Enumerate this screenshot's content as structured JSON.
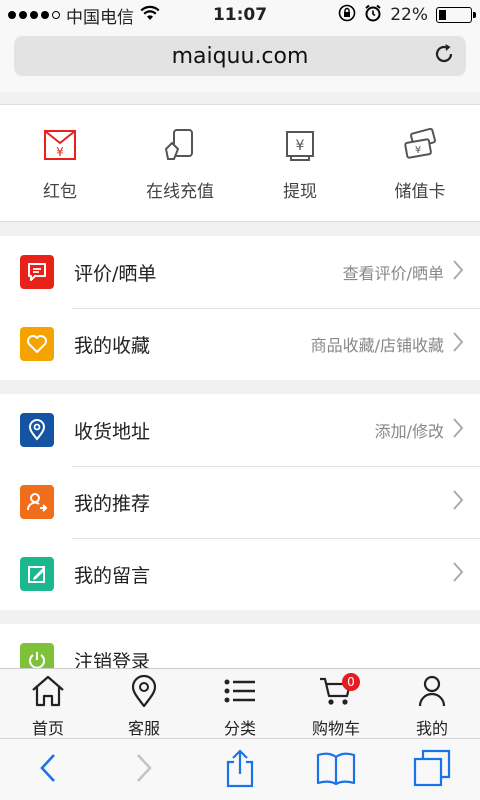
{
  "status": {
    "carrier": "中国电信",
    "time": "11:07",
    "battery": "22%",
    "battery_level": 0.22
  },
  "url": {
    "domain": "maiquu.com"
  },
  "wallet": [
    {
      "label": "红包",
      "icon": "red-envelope-icon"
    },
    {
      "label": "在线充值",
      "icon": "recharge-icon"
    },
    {
      "label": "提现",
      "icon": "withdraw-icon"
    },
    {
      "label": "储值卡",
      "icon": "stored-value-card-icon"
    }
  ],
  "groups": [
    [
      {
        "title": "评价/晒单",
        "sub": "查看评价/晒单",
        "icon": "review-icon",
        "color": "#e8211b"
      },
      {
        "title": "我的收藏",
        "sub": "商品收藏/店铺收藏",
        "icon": "heart-icon",
        "color": "#f5a300"
      }
    ],
    [
      {
        "title": "收货地址",
        "sub": "添加/修改",
        "icon": "location-icon",
        "color": "#1554a3"
      },
      {
        "title": "我的推荐",
        "sub": "",
        "icon": "referral-icon",
        "color": "#ef6d1b"
      },
      {
        "title": "我的留言",
        "sub": "",
        "icon": "message-edit-icon",
        "color": "#1bb88f"
      }
    ],
    [
      {
        "title": "注销登录",
        "sub": "",
        "icon": "power-icon",
        "color": "#7fc23a"
      }
    ]
  ],
  "tabs": [
    {
      "label": "首页",
      "icon": "home-icon"
    },
    {
      "label": "客服",
      "icon": "location-pin-icon"
    },
    {
      "label": "分类",
      "icon": "list-icon"
    },
    {
      "label": "购物车",
      "icon": "cart-icon",
      "badge": "0"
    },
    {
      "label": "我的",
      "icon": "user-icon"
    }
  ],
  "colors": {
    "accent": "#e8211b",
    "ios_blue": "#1a73e8"
  }
}
